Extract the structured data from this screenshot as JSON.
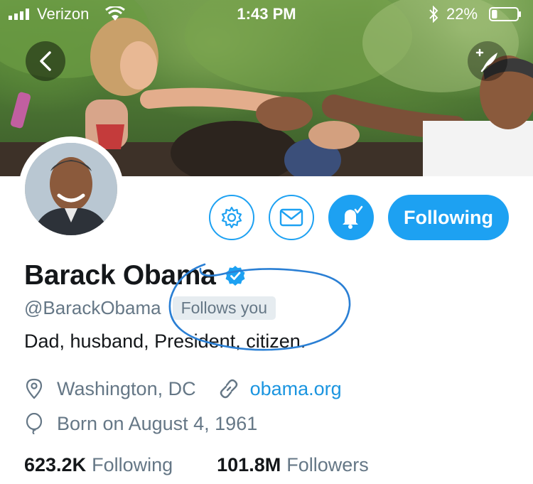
{
  "status_bar": {
    "carrier": "Verizon",
    "time": "1:43 PM",
    "battery": "22%",
    "battery_level": 0.22
  },
  "header": {
    "back_icon": "chevron-left-icon",
    "compose_icon": "compose-tweet-icon"
  },
  "actions": {
    "settings_icon": "gear-icon",
    "message_icon": "envelope-icon",
    "notify_icon": "bell-check-icon",
    "following_label": "Following"
  },
  "profile": {
    "name": "Barack Obama",
    "verified": true,
    "handle": "@BarackObama",
    "follows_you": "Follows you",
    "bio": "Dad, husband, President, citizen.",
    "location": "Washington, DC",
    "url": "obama.org",
    "born": "Born on August 4, 1961",
    "following_count": "623.2K",
    "following_label": "Following",
    "followers_count": "101.8M",
    "followers_label": "Followers"
  },
  "colors": {
    "accent": "#1da1f2",
    "link": "#1b95e0",
    "secondary_text": "#657786",
    "annotation": "#2a7fd4"
  }
}
